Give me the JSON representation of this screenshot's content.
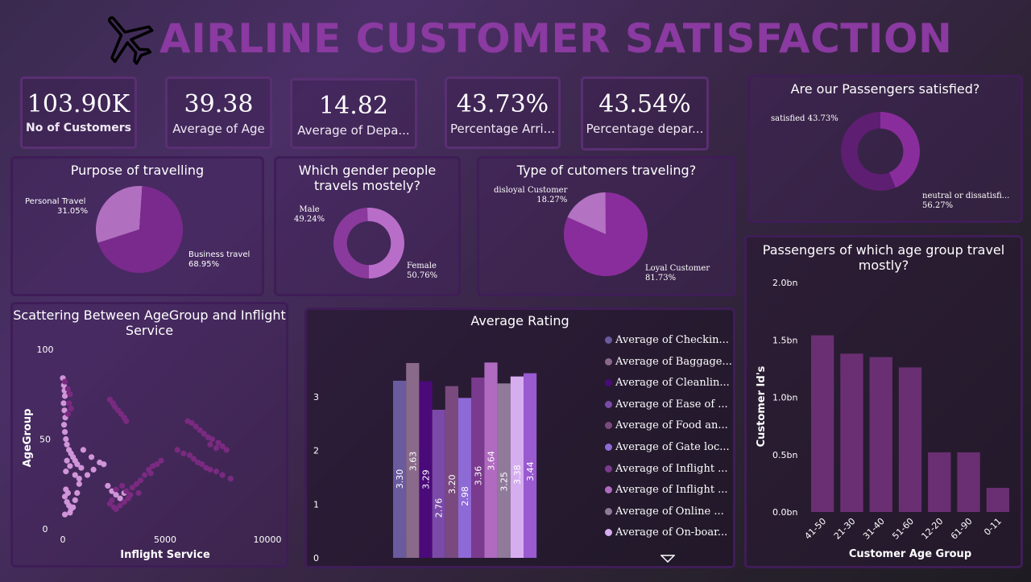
{
  "header": {
    "title": "AIRLINE CUSTOMER SATISFACTION"
  },
  "kpis": [
    {
      "value": "103.90K",
      "label": "No of Customers"
    },
    {
      "value": "39.38",
      "label": "Average of Age"
    },
    {
      "value": "14.82",
      "label": "Average of Depa..."
    },
    {
      "value": "43.73%",
      "label": "Percentage Arri..."
    },
    {
      "value": "43.54%",
      "label": "Percentage depar..."
    }
  ],
  "purpose": {
    "title": "Purpose of travelling",
    "slices": [
      {
        "name": "Personal Travel",
        "pct_label": "31.05%",
        "value": 31.05,
        "color": "#b16fbf"
      },
      {
        "name": "Business travel",
        "pct_label": "68.95%",
        "value": 68.95,
        "color": "#7a2a8c"
      }
    ]
  },
  "gender": {
    "title": "Which gender people travels mostely?",
    "slices": [
      {
        "name": "Male",
        "pct_label": "49.24%",
        "value": 49.24,
        "color": "#8a3a9c"
      },
      {
        "name": "Female",
        "pct_label": "50.76%",
        "value": 50.76,
        "color": "#b86ec8"
      }
    ]
  },
  "custtype": {
    "title": "Type of cutomers traveling?",
    "slices": [
      {
        "name": "disloyal Customer",
        "pct_label": "18.27%",
        "value": 18.27,
        "color": "#b472c2"
      },
      {
        "name": "Loyal Customer",
        "pct_label": "81.73%",
        "value": 81.73,
        "color": "#8a2d9c"
      }
    ]
  },
  "satisfied": {
    "title": "Are our Passengers satisfied?",
    "slices": [
      {
        "name": "satisfied",
        "pct_label": "43.73%",
        "value": 43.73,
        "color": "#8a2d9c"
      },
      {
        "name": "neutral or dissatisfi...",
        "pct_label": "56.27%",
        "value": 56.27,
        "color": "#5e1e72"
      }
    ]
  },
  "chart_data": [
    {
      "type": "bar",
      "title": "Passengers of which age group travel mostly?",
      "xlabel": "Customer Age Group",
      "ylabel": "Customer Id's",
      "categories": [
        "41-50",
        "21-30",
        "31-40",
        "51-60",
        "12-20",
        "61-90",
        "0-11"
      ],
      "values": [
        1.54,
        1.38,
        1.35,
        1.26,
        0.52,
        0.52,
        0.21
      ],
      "ylim": [
        0,
        2.0
      ],
      "yticks": [
        "0.0bn",
        "0.5bn",
        "1.0bn",
        "1.5bn",
        "2.0bn"
      ],
      "color": "#6a2f73"
    },
    {
      "type": "bar",
      "title": "Average Rating",
      "categories": [
        "Average of Checkin...",
        "Average of Baggage...",
        "Average of Cleanlin...",
        "Average of Ease of ...",
        "Average of Food an...",
        "Average of Gate loc...",
        "Average of Inflight ...",
        "Average of Inflight ...",
        "Average of Online ...",
        "Average of On-boar..."
      ],
      "values": [
        3.3,
        3.63,
        3.29,
        2.76,
        3.2,
        2.98,
        3.36,
        3.64,
        3.25,
        3.38,
        3.44
      ],
      "value_labels": [
        "3.30",
        "3.63",
        "3.29",
        "2.76",
        "3.20",
        "2.98",
        "3.36",
        "3.64",
        "3.25",
        "3.38",
        "3.44"
      ],
      "colors": [
        "#6a5a9e",
        "#8a6a8a",
        "#4a0a7a",
        "#7b4aa8",
        "#7a4a7e",
        "#8e6ad6",
        "#7a3a8e",
        "#b06ac0",
        "#907a9a",
        "#d6aef0",
        "#9a5ad0"
      ],
      "yticks": [
        "0",
        "1",
        "2",
        "3"
      ],
      "ylim": [
        0,
        4.05
      ]
    },
    {
      "type": "scatter",
      "title": "Scattering Between AgeGroup and Inflight Service",
      "xlabel": "Inflight Service",
      "ylabel": "AgeGroup",
      "xticks": [
        "0",
        "5000",
        "10000"
      ],
      "yticks": [
        "0",
        "50",
        "100"
      ],
      "xlim": [
        0,
        10000
      ],
      "ylim": [
        0,
        100
      ],
      "series": [
        {
          "color": "#d095d8",
          "points": [
            [
              0,
              84
            ],
            [
              50,
              80
            ],
            [
              80,
              77
            ],
            [
              100,
              74
            ],
            [
              40,
              70
            ],
            [
              80,
              66
            ],
            [
              120,
              62
            ],
            [
              60,
              58
            ],
            [
              100,
              54
            ],
            [
              150,
              50
            ],
            [
              200,
              47
            ],
            [
              300,
              44
            ],
            [
              400,
              42
            ],
            [
              500,
              40
            ],
            [
              600,
              38
            ],
            [
              700,
              36
            ],
            [
              900,
              34
            ],
            [
              200,
              38
            ],
            [
              350,
              35
            ],
            [
              150,
              32
            ],
            [
              600,
              30
            ],
            [
              800,
              28
            ],
            [
              1200,
              30
            ],
            [
              1500,
              33
            ],
            [
              1800,
              37
            ],
            [
              2000,
              36
            ],
            [
              1400,
              40
            ],
            [
              1000,
              44
            ],
            [
              100,
              18
            ],
            [
              200,
              15
            ],
            [
              300,
              13
            ],
            [
              400,
              11
            ],
            [
              500,
              12
            ],
            [
              600,
              16
            ],
            [
              700,
              20
            ],
            [
              800,
              25
            ],
            [
              150,
              22
            ],
            [
              250,
              20
            ],
            [
              2200,
              24
            ],
            [
              2400,
              21
            ],
            [
              2600,
              19
            ],
            [
              2800,
              17
            ],
            [
              3000,
              20
            ],
            [
              350,
              9
            ],
            [
              100,
              8
            ]
          ]
        },
        {
          "color": "#7a2a80",
          "points": [
            [
              100,
              82
            ],
            [
              250,
              78
            ],
            [
              350,
              75
            ],
            [
              300,
              70
            ],
            [
              400,
              67
            ],
            [
              250,
              64
            ],
            [
              2300,
              72
            ],
            [
              2450,
              70
            ],
            [
              2550,
              68
            ],
            [
              2700,
              66
            ],
            [
              2850,
              64
            ],
            [
              3000,
              62
            ],
            [
              3100,
              60
            ],
            [
              6100,
              60
            ],
            [
              6300,
              59
            ],
            [
              6500,
              57
            ],
            [
              6700,
              55
            ],
            [
              6900,
              53
            ],
            [
              7100,
              51
            ],
            [
              7300,
              50
            ],
            [
              7600,
              48
            ],
            [
              7800,
              46
            ],
            [
              8000,
              44
            ],
            [
              7200,
              47
            ],
            [
              7500,
              45
            ],
            [
              2400,
              16
            ],
            [
              2300,
              14
            ],
            [
              2500,
              12
            ],
            [
              2600,
              11
            ],
            [
              2800,
              13
            ],
            [
              3000,
              15
            ],
            [
              3200,
              17
            ],
            [
              3300,
              19
            ],
            [
              3400,
              23
            ],
            [
              3600,
              25
            ],
            [
              3800,
              27
            ],
            [
              4000,
              30
            ],
            [
              4200,
              33
            ],
            [
              4400,
              35
            ],
            [
              4600,
              36
            ],
            [
              4800,
              38
            ],
            [
              4300,
              31
            ],
            [
              5600,
              44
            ],
            [
              5900,
              42
            ],
            [
              6200,
              41
            ],
            [
              6400,
              39
            ],
            [
              6600,
              37
            ],
            [
              6800,
              36
            ],
            [
              7000,
              34
            ],
            [
              7200,
              33
            ],
            [
              7500,
              32
            ],
            [
              7800,
              30
            ],
            [
              8200,
              28
            ],
            [
              2600,
              22
            ],
            [
              2900,
              24
            ],
            [
              3100,
              21
            ],
            [
              3700,
              20
            ]
          ]
        }
      ]
    }
  ]
}
